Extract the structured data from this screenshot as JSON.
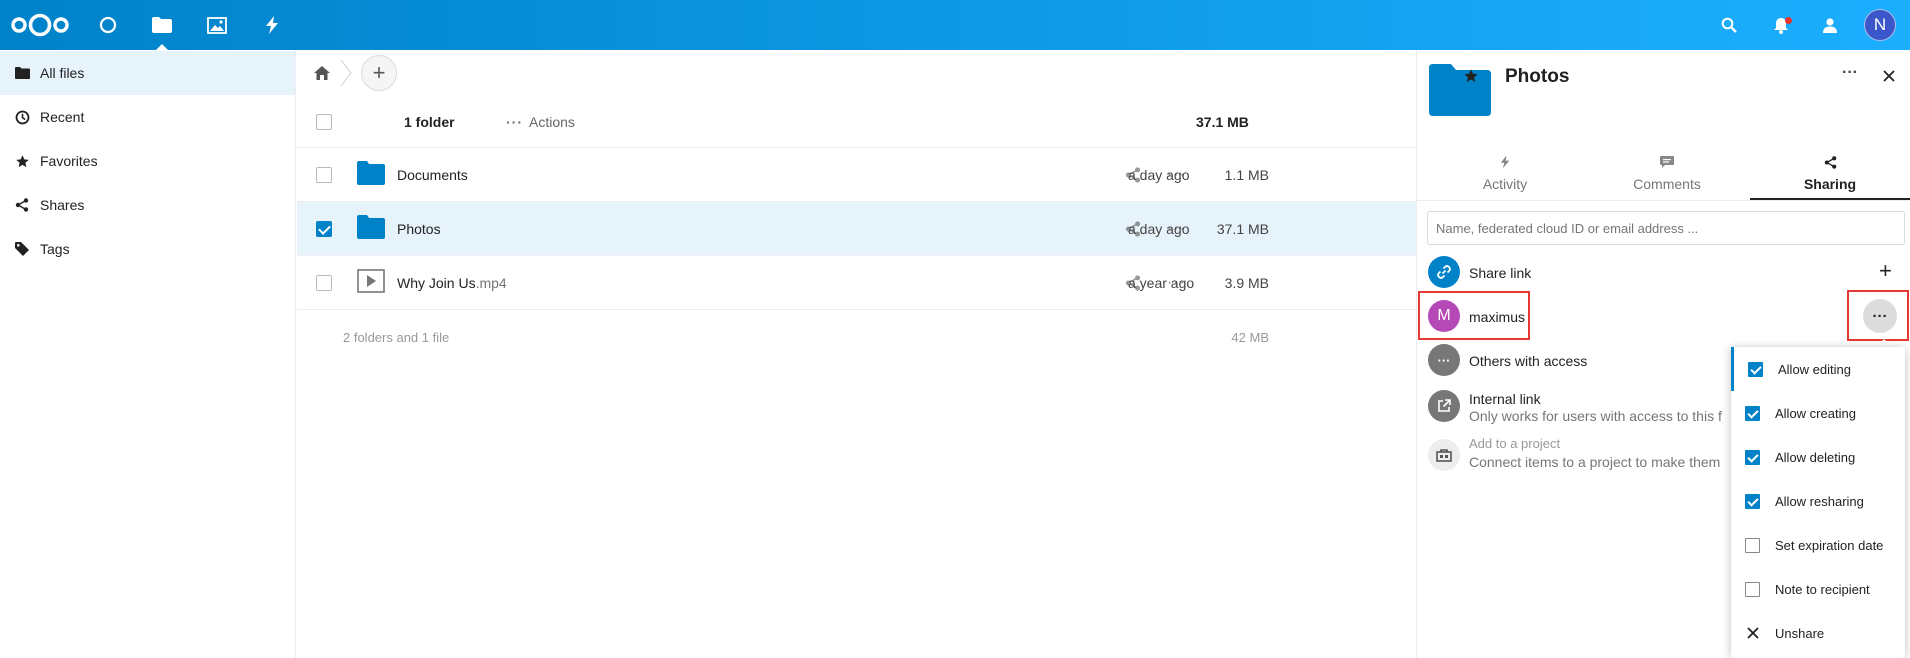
{
  "colors": {
    "brand": "#0082c9",
    "accent": "#1cafff",
    "highlight": "#e53935",
    "selected_bg": "#e7f3fa"
  },
  "header": {
    "nav": [
      "logo-icon",
      "dashboard-icon",
      "files-icon",
      "photos-icon",
      "activity-icon"
    ],
    "right": [
      "search-icon",
      "notifications-icon",
      "contacts-icon"
    ],
    "user_initial": "N"
  },
  "sidebar": {
    "items": [
      {
        "label": "All files",
        "icon": "folder-icon",
        "active": true
      },
      {
        "label": "Recent",
        "icon": "clock-icon"
      },
      {
        "label": "Favorites",
        "icon": "star-icon"
      },
      {
        "label": "Shares",
        "icon": "share-icon"
      },
      {
        "label": "Tags",
        "icon": "tag-icon"
      }
    ]
  },
  "files": {
    "add_label": "+",
    "header": {
      "count": "1 folder",
      "actions": "Actions",
      "size": "37.1 MB"
    },
    "rows": [
      {
        "name": "Documents",
        "ext": "",
        "size": "1.1 MB",
        "date": "a day ago",
        "selected": false
      },
      {
        "name": "Photos",
        "ext": "",
        "size": "37.1 MB",
        "date": "a day ago",
        "selected": true
      },
      {
        "name": "Why Join Us",
        "ext": ".mp4",
        "size": "3.9 MB",
        "date": "a year ago",
        "selected": false
      }
    ],
    "summary": {
      "text": "2 folders and 1 file",
      "size": "42 MB"
    }
  },
  "details": {
    "title": "Photos",
    "tabs": [
      {
        "label": "Activity",
        "icon": "activity-icon"
      },
      {
        "label": "Comments",
        "icon": "comment-icon"
      },
      {
        "label": "Sharing",
        "icon": "share-icon",
        "active": true
      }
    ],
    "search_placeholder": "Name, federated cloud ID or email address ...",
    "share_link": "Share link",
    "share_user": {
      "initial": "M",
      "name": "maximus"
    },
    "others_access": "Others with access",
    "internal_link": {
      "title": "Internal link",
      "sub": "Only works for users with access to this folder"
    },
    "project": {
      "title": "Add to a project",
      "sub": "Connect items to a project to make them easier to find"
    }
  },
  "menu": {
    "items": [
      {
        "label": "Allow editing",
        "checked": true
      },
      {
        "label": "Allow creating",
        "checked": true
      },
      {
        "label": "Allow deleting",
        "checked": true
      },
      {
        "label": "Allow resharing",
        "checked": true
      },
      {
        "label": "Set expiration date",
        "checked": false
      },
      {
        "label": "Note to recipient",
        "checked": false
      },
      {
        "label": "Unshare",
        "icon": "close-icon"
      }
    ]
  }
}
